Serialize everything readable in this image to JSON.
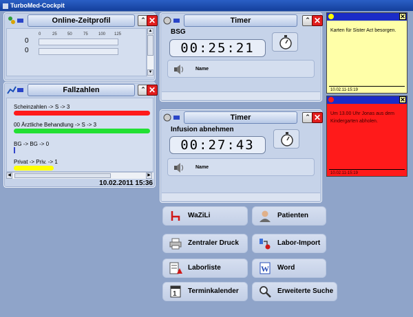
{
  "window": {
    "title": "TurboMed-Cockpit"
  },
  "online_profile": {
    "title": "Online-Zeitprofil",
    "scale": [
      "0",
      "25",
      "50",
      "75",
      "100",
      "125"
    ],
    "rows": [
      {
        "value": "0"
      },
      {
        "value": "0"
      }
    ]
  },
  "fallzahlen": {
    "title": "Fallzahlen",
    "rows": [
      {
        "label": "Scheinzahlen -> S -> 3",
        "color": "#ff1a1a",
        "fill": 1.0
      },
      {
        "label": "00 Ärztliche Behandlung  -> S -> 3",
        "color": "#22e033",
        "fill": 1.0
      },
      {
        "label": "BG   -> BG -> 0",
        "color": "#3344cc",
        "fill": 0.0
      },
      {
        "label": "Privat   -> Priv. -> 1",
        "color": "#ffff00",
        "fill": 0.3
      }
    ],
    "date": "10.02.2011 15:36"
  },
  "timers": [
    {
      "title": "Timer",
      "name": "BSG",
      "time": "00:25:21",
      "sub_label": "Name"
    },
    {
      "title": "Timer",
      "name": "Infusion abnehmen",
      "time": "00:27:43",
      "sub_label": "Name"
    }
  ],
  "notes": [
    {
      "text": "Karten für Sister Act besorgen.",
      "date": "10.02.11-15:19",
      "bg": "#ffffa8"
    },
    {
      "text": "Um 13.00 Uhr Jonas aus dem Kindergarten abholen.",
      "date": "10.02.11-15:19",
      "bg": "#ff1a1a"
    }
  ],
  "launchers": {
    "wazili": "WaZiLi",
    "patienten": "Patienten",
    "zentraler_druck": "Zentraler Druck",
    "labor_import": "Labor-Import",
    "laborliste": "Laborliste",
    "word": "Word",
    "terminkalender": "Terminkalender",
    "erweiterte_suche": "Erweiterte Suche"
  },
  "colors": {
    "desktop": "#8fa4c9",
    "panel": "#c6d3e9",
    "close": "#e11d1d",
    "titlebar": "#1f4fb5"
  }
}
